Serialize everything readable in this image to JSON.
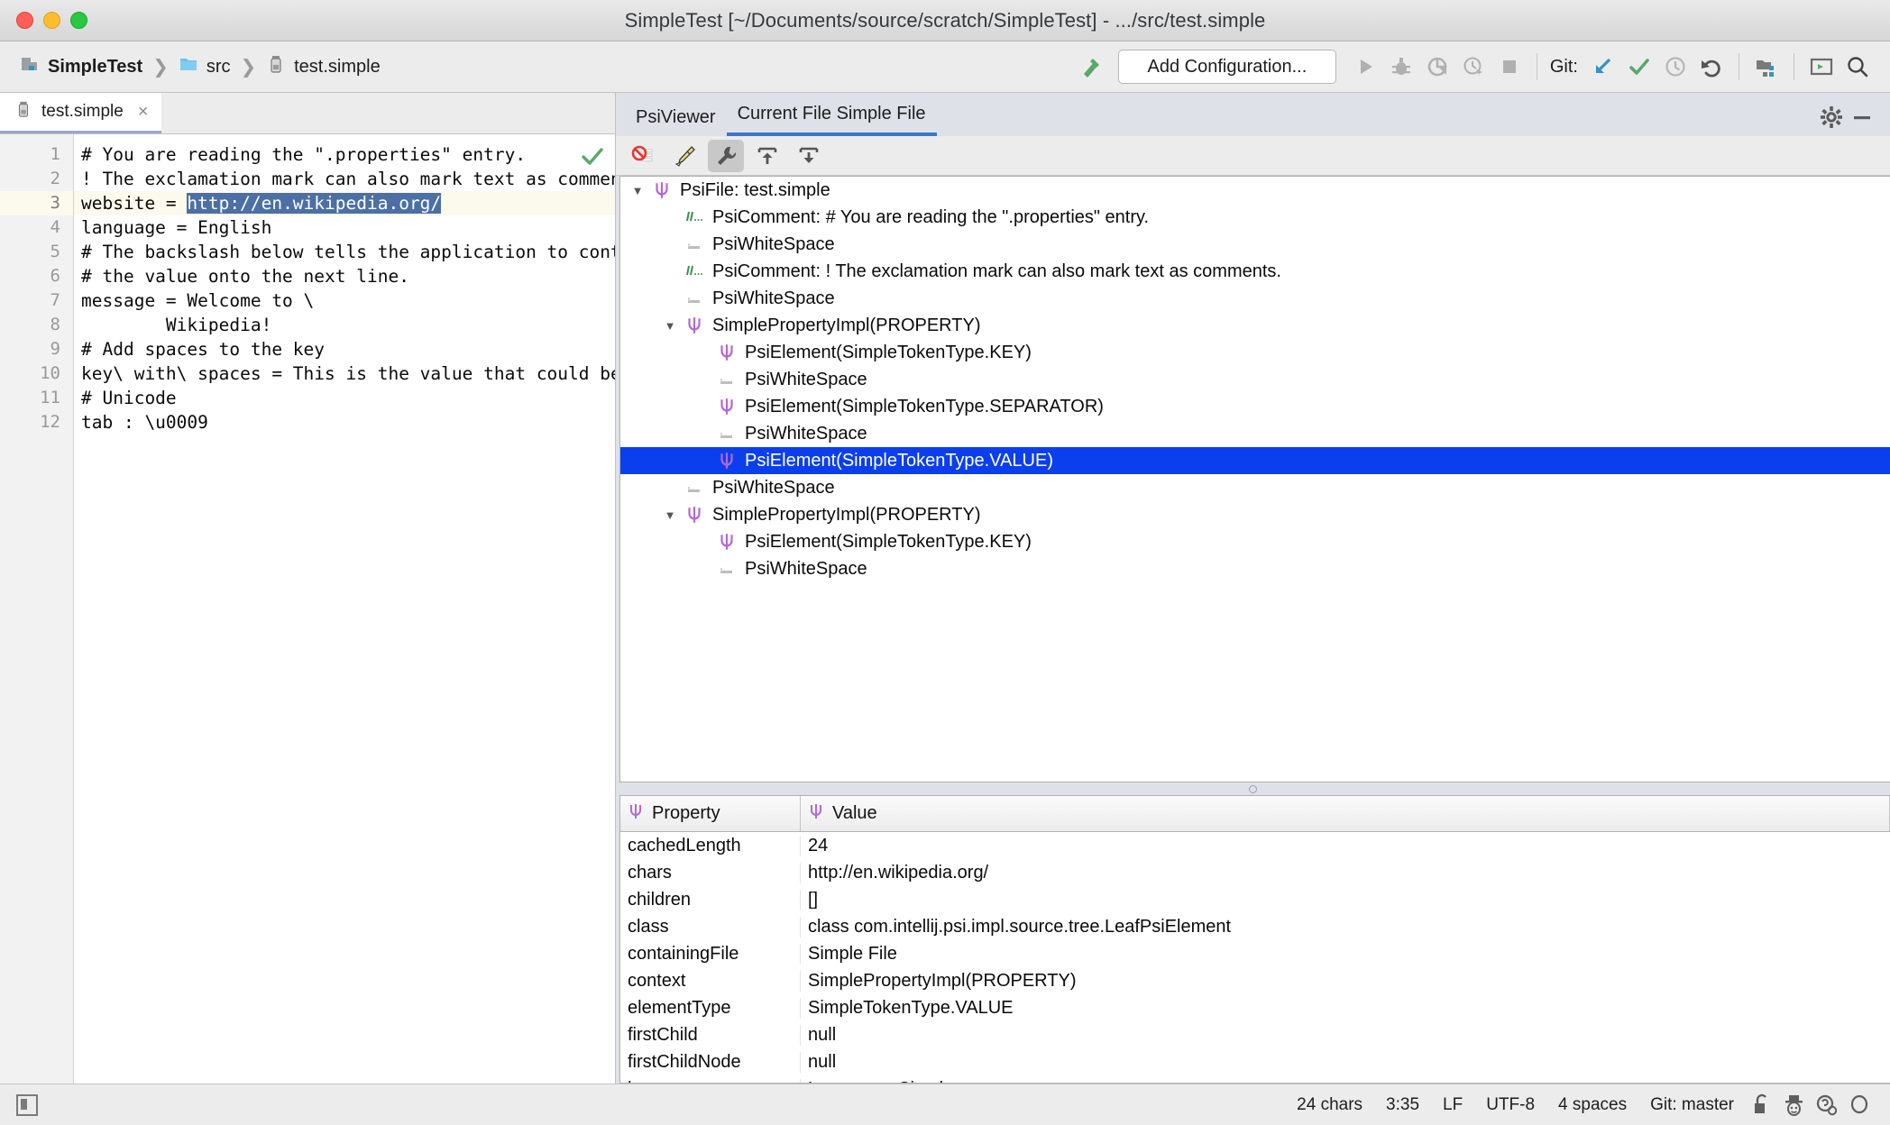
{
  "window": {
    "title": "SimpleTest [~/Documents/source/scratch/SimpleTest] - .../src/test.simple"
  },
  "navbar": {
    "breadcrumb": [
      {
        "label": "SimpleTest",
        "icon": "module-icon"
      },
      {
        "label": "src",
        "icon": "folder-icon"
      },
      {
        "label": "test.simple",
        "icon": "simple-file-icon"
      }
    ],
    "add_configuration": "Add Configuration...",
    "git_label": "Git:",
    "buttons": [
      {
        "name": "run-button",
        "icon": "play-icon"
      },
      {
        "name": "debug-button",
        "icon": "bug-icon"
      },
      {
        "name": "run-with-coverage-button",
        "icon": "coverage-icon"
      },
      {
        "name": "profiler-button",
        "icon": "profiler-icon"
      },
      {
        "name": "stop-button",
        "icon": "stop-icon"
      },
      {
        "name": "git-update-button",
        "icon": "update-project-icon"
      },
      {
        "name": "git-commit-button",
        "icon": "commit-icon"
      },
      {
        "name": "git-history-button",
        "icon": "history-icon"
      },
      {
        "name": "git-rollback-button",
        "icon": "rollback-icon"
      },
      {
        "name": "select-in-project-button",
        "icon": "locate-file-icon"
      },
      {
        "name": "terminal-button",
        "icon": "terminal-icon"
      },
      {
        "name": "search-everywhere-button",
        "icon": "search-icon"
      }
    ],
    "build-icon": "hammer-icon"
  },
  "editor": {
    "tab": {
      "label": "test.simple",
      "close": "×",
      "icon": "simple-file-icon"
    },
    "inspection_status": "ok-checkmark",
    "current_line": 3,
    "lines": [
      {
        "n": 1,
        "text": "# You are reading the \".properties\" entry."
      },
      {
        "n": 2,
        "text": "! The exclamation mark can also mark text as comments."
      },
      {
        "n": 3,
        "pre": "website = ",
        "selected": "http://en.wikipedia.org/",
        "post": ""
      },
      {
        "n": 4,
        "text": "language = English"
      },
      {
        "n": 5,
        "text": "# The backslash below tells the application to continue r"
      },
      {
        "n": 6,
        "text": "# the value onto the next line."
      },
      {
        "n": 7,
        "text": "message = Welcome to \\"
      },
      {
        "n": 8,
        "text": "        Wikipedia!"
      },
      {
        "n": 9,
        "text": "# Add spaces to the key"
      },
      {
        "n": 10,
        "text": "key\\ with\\ spaces = This is the value that could be looke"
      },
      {
        "n": 11,
        "text": "# Unicode"
      },
      {
        "n": 12,
        "text": "tab : \\u0009"
      }
    ]
  },
  "psi_panel": {
    "tabs": [
      {
        "label": "PsiViewer",
        "active": false
      },
      {
        "label": "Current File Simple File",
        "active": true
      }
    ],
    "header_icons": [
      {
        "name": "settings-gear-icon"
      },
      {
        "name": "hide-panel-icon"
      }
    ],
    "toolbar": [
      {
        "name": "disable-psi-icon",
        "icon": "block-icon",
        "selected": false
      },
      {
        "name": "clear-highlighting-icon",
        "icon": "brush-icon",
        "selected": false
      },
      {
        "name": "psi-settings-icon",
        "icon": "wrench-icon",
        "selected": true
      },
      {
        "name": "export-icon",
        "icon": "arrow-up-bar-icon",
        "selected": false
      },
      {
        "name": "import-icon",
        "icon": "arrow-down-bar-icon",
        "selected": false
      }
    ],
    "tree": [
      {
        "depth": 0,
        "arrow": "down",
        "icon": "psi-icon",
        "label": "PsiFile: test.simple",
        "selected": false
      },
      {
        "depth": 1,
        "arrow": "none",
        "icon": "comment-icon",
        "label": "PsiComment: # You are reading the \".properties\" entry.",
        "selected": false
      },
      {
        "depth": 1,
        "arrow": "none",
        "icon": "whitespace-icon",
        "label": "PsiWhiteSpace",
        "selected": false
      },
      {
        "depth": 1,
        "arrow": "none",
        "icon": "comment-icon",
        "label": "PsiComment: ! The exclamation mark can also mark text as comments.",
        "selected": false
      },
      {
        "depth": 1,
        "arrow": "none",
        "icon": "whitespace-icon",
        "label": "PsiWhiteSpace",
        "selected": false
      },
      {
        "depth": 1,
        "arrow": "down",
        "icon": "psi-icon",
        "label": "SimplePropertyImpl(PROPERTY)",
        "selected": false
      },
      {
        "depth": 2,
        "arrow": "none",
        "icon": "psi-icon",
        "label": "PsiElement(SimpleTokenType.KEY)",
        "selected": false
      },
      {
        "depth": 2,
        "arrow": "none",
        "icon": "whitespace-icon",
        "label": "PsiWhiteSpace",
        "selected": false
      },
      {
        "depth": 2,
        "arrow": "none",
        "icon": "psi-icon",
        "label": "PsiElement(SimpleTokenType.SEPARATOR)",
        "selected": false
      },
      {
        "depth": 2,
        "arrow": "none",
        "icon": "whitespace-icon",
        "label": "PsiWhiteSpace",
        "selected": false
      },
      {
        "depth": 2,
        "arrow": "none",
        "icon": "psi-icon",
        "label": "PsiElement(SimpleTokenType.VALUE)",
        "selected": true
      },
      {
        "depth": 1,
        "arrow": "none",
        "icon": "whitespace-icon",
        "label": "PsiWhiteSpace",
        "selected": false
      },
      {
        "depth": 1,
        "arrow": "down",
        "icon": "psi-icon",
        "label": "SimplePropertyImpl(PROPERTY)",
        "selected": false
      },
      {
        "depth": 2,
        "arrow": "none",
        "icon": "psi-icon",
        "label": "PsiElement(SimpleTokenType.KEY)",
        "selected": false
      },
      {
        "depth": 2,
        "arrow": "none",
        "icon": "whitespace-icon",
        "label": "PsiWhiteSpace",
        "selected": false
      }
    ],
    "property_table": {
      "columns": [
        {
          "label": "Property",
          "icon": "psi-icon"
        },
        {
          "label": "Value",
          "icon": "psi-icon"
        }
      ],
      "rows": [
        {
          "property": "cachedLength",
          "value": "24"
        },
        {
          "property": "chars",
          "value": "http://en.wikipedia.org/"
        },
        {
          "property": "children",
          "value": "[]"
        },
        {
          "property": "class",
          "value": "class com.intellij.psi.impl.source.tree.LeafPsiElement"
        },
        {
          "property": "containingFile",
          "value": "Simple File"
        },
        {
          "property": "context",
          "value": "SimplePropertyImpl(PROPERTY)"
        },
        {
          "property": "elementType",
          "value": "SimpleTokenType.VALUE"
        },
        {
          "property": "firstChild",
          "value": "null"
        },
        {
          "property": "firstChildNode",
          "value": "null"
        },
        {
          "property": "language",
          "value": "Language: Simple"
        }
      ]
    }
  },
  "statusbar": {
    "items": [
      "24 chars",
      "3:35",
      "LF",
      "UTF-8",
      "4 spaces",
      "Git: master"
    ],
    "icons": [
      {
        "name": "lock-icon"
      },
      {
        "name": "inspector-hat-icon"
      },
      {
        "name": "background-tasks-icon"
      },
      {
        "name": "search-icon"
      }
    ],
    "toggle": {
      "name": "toggle-tool-window-bars"
    }
  },
  "colors": {
    "selection_blue": "#0b3fee",
    "editor_selection": "#4c6fa5",
    "tab_underline": "#3c77c9",
    "panel_bg": "#dfe1e8",
    "psi_purple": "#b368d6",
    "comment_green": "#3e8f4e",
    "accent_green": "#59a869",
    "accent_blue": "#3592c4"
  }
}
